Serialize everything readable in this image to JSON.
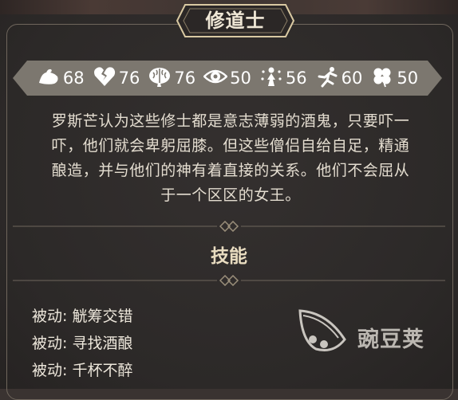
{
  "title": "修道士",
  "stats": [
    {
      "icon": "muscle-icon",
      "value": "68"
    },
    {
      "icon": "broken-heart-icon",
      "value": "76"
    },
    {
      "icon": "brain-icon",
      "value": "76"
    },
    {
      "icon": "eye-icon",
      "value": "50"
    },
    {
      "icon": "spirit-icon",
      "value": "56"
    },
    {
      "icon": "running-figure-icon",
      "value": "60"
    },
    {
      "icon": "clover-icon",
      "value": "50"
    }
  ],
  "description": [
    "罗斯芒认为这些修士都是意志薄弱的酒鬼，只要吓一",
    "吓，他们就会卑躬屈膝。但这些僧侣自给自足，精通",
    "酿造，并与他们的神有着直接的关系。他们不会屈从",
    "于一个区区的女王。"
  ],
  "skills_title": "技能",
  "skills": [
    "被动: 觥筹交错",
    "被动: 寻找酒酿",
    "被动: 千杯不醉"
  ],
  "watermark": "豌豆荚",
  "colors": {
    "panel": "#2c2928",
    "border": "#6f665c",
    "stat_bar": "#7c776f",
    "gold_accent": "#d9c9a2",
    "text": "#e4ddd0"
  }
}
